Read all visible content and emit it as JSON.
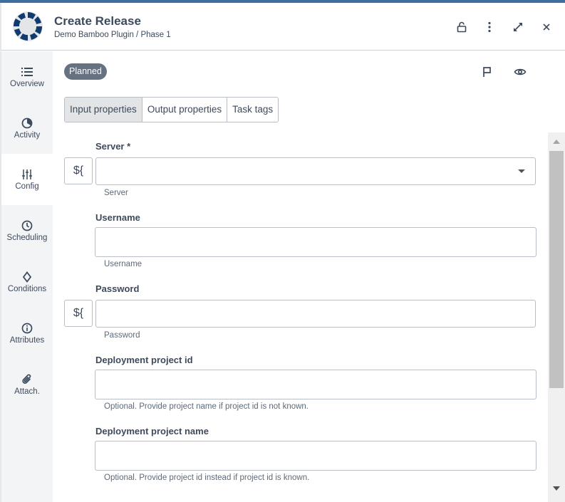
{
  "header": {
    "title": "Create Release",
    "subtitle": "Demo Bamboo Plugin / Phase 1",
    "icons": [
      "lock-open-icon",
      "more-vertical-icon",
      "expand-icon",
      "close-icon"
    ]
  },
  "sidebar": {
    "items": [
      {
        "label": "Overview",
        "icon": "list-icon",
        "active": false
      },
      {
        "label": "Activity",
        "icon": "activity-icon",
        "active": false
      },
      {
        "label": "Config",
        "icon": "sliders-icon",
        "active": true
      },
      {
        "label": "Scheduling",
        "icon": "clock-icon",
        "active": false
      },
      {
        "label": "Conditions",
        "icon": "diamond-icon",
        "active": false
      },
      {
        "label": "Attributes",
        "icon": "info-icon",
        "active": false
      },
      {
        "label": "Attach.",
        "icon": "paperclip-icon",
        "active": false
      }
    ]
  },
  "status": {
    "badge": "Planned",
    "badge_color": "#667181"
  },
  "actions": [
    "flag-icon",
    "watch-eye-icon"
  ],
  "tabs": [
    {
      "label": "Input properties",
      "active": true
    },
    {
      "label": "Output properties",
      "active": false
    },
    {
      "label": "Task tags",
      "active": false
    }
  ],
  "form": {
    "fields": [
      {
        "label": "Server *",
        "type": "select",
        "value": "",
        "help": "Server",
        "variable_button": "${"
      },
      {
        "label": "Username",
        "type": "text",
        "value": "",
        "help": "Username"
      },
      {
        "label": "Password",
        "type": "password",
        "value": "",
        "help": "Password",
        "variable_button": "${"
      },
      {
        "label": "Deployment project id",
        "type": "text",
        "value": "",
        "help": "Optional. Provide project name if project id is not known."
      },
      {
        "label": "Deployment project name",
        "type": "text",
        "value": "",
        "help": "Optional. Provide project id instead if project id is known."
      }
    ]
  },
  "colors": {
    "accent_bar": "#3c6e9f",
    "logo": "#0f3b6e"
  }
}
